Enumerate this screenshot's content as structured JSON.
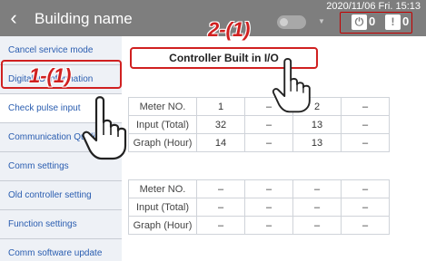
{
  "header": {
    "back_glyph": "‹",
    "title": "Building name",
    "datetime": "2020/11/06 Fri. 15:13",
    "power_count": "0",
    "alarm_count": "0",
    "power_icon": "power-icon",
    "alarm_icon": "alarm-warning-icon"
  },
  "annotations": {
    "step1": "1-(1)",
    "step2": "2-(1)"
  },
  "sidebar": {
    "items": [
      {
        "label": "Cancel service mode"
      },
      {
        "label": "Digital IO information"
      },
      {
        "label": "Check pulse input"
      },
      {
        "label": "Communication Quality"
      },
      {
        "label": "Comm settings"
      },
      {
        "label": "Old controller setting"
      },
      {
        "label": "Function settings"
      },
      {
        "label": "Comm software update"
      }
    ]
  },
  "main": {
    "panel_title": "Controller Built in I/O",
    "table1": {
      "rows": [
        {
          "label": "Meter NO.",
          "cells": [
            "1",
            "–",
            "2",
            "–"
          ]
        },
        {
          "label": "Input (Total)",
          "cells": [
            "32",
            "–",
            "13",
            "–"
          ]
        },
        {
          "label": "Graph (Hour)",
          "cells": [
            "14",
            "–",
            "13",
            "–"
          ]
        }
      ]
    },
    "table2": {
      "rows": [
        {
          "label": "Meter NO.",
          "cells": [
            "–",
            "–",
            "–",
            "–"
          ]
        },
        {
          "label": "Input (Total)",
          "cells": [
            "–",
            "–",
            "–",
            "–"
          ]
        },
        {
          "label": "Graph (Hour)",
          "cells": [
            "–",
            "–",
            "–",
            "–"
          ]
        }
      ]
    }
  }
}
